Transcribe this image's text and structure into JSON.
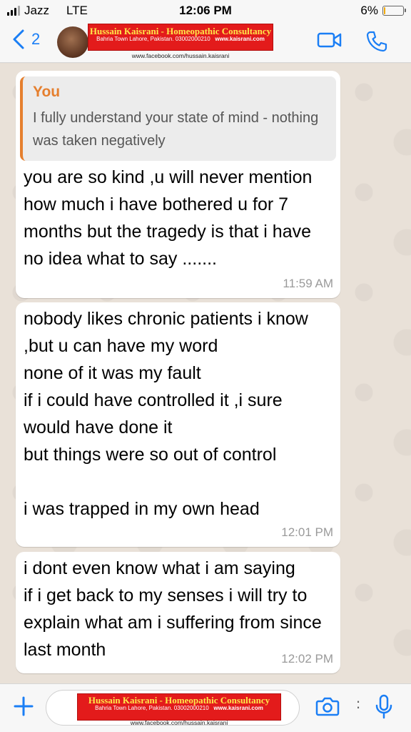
{
  "status_bar": {
    "carrier": "Jazz",
    "network": "LTE",
    "time": "12:06 PM",
    "battery": "6%",
    "battery_level": 0.06
  },
  "header": {
    "back_count": "2",
    "banner_title": "Hussain Kaisrani - Homeopathic Consultancy",
    "banner_address": "Bahria Town Lahore, Pakistan. 03002000210",
    "banner_site": "www.kaisrani.com",
    "banner_facebook": "www.facebook.com/hussain.kaisrani"
  },
  "messages": [
    {
      "quote_author": "You",
      "quote_text": "I fully understand your state of mind - nothing was taken negatively",
      "text": "you are so kind ,u will never mention how much i have bothered u for 7 months but the tragedy is that i have no idea what to say .......",
      "time": "11:59 AM"
    },
    {
      "text": "nobody likes chronic patients i know ,but u can have my word\nnone of it was my fault\nif i could have controlled it ,i sure would have done it\nbut things were so out of control\n\ni was trapped in my own head",
      "time": "12:01 PM"
    },
    {
      "text": "i dont even know what i am saying\nif i get back to my senses i will try to explain what am i suffering from since last month",
      "time": "12:02 PM"
    }
  ],
  "input_bar": {
    "banner_title": "Hussain Kaisrani - Homeopathic Consultancy",
    "banner_address": "Bahria Town Lahore, Pakistan. 03002000210",
    "banner_site": "www.kaisrani.com",
    "banner_facebook": "www.facebook.com/hussain.kaisrani"
  },
  "colors": {
    "accent": "#1a7ef5",
    "quote_author": "#e57f2e",
    "banner_red": "#e31b1b"
  }
}
